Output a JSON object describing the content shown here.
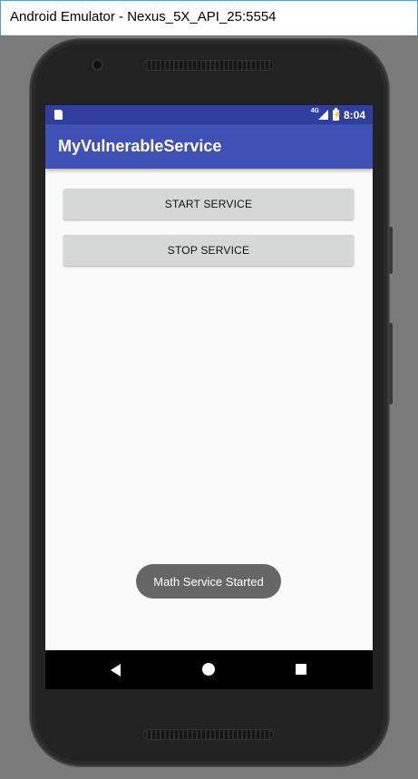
{
  "window": {
    "title": "Android Emulator - Nexus_5X_API_25:5554"
  },
  "statusbar": {
    "network": "4G",
    "time": "8:04",
    "icons": [
      "sd-card-icon",
      "signal-icon",
      "battery-charging-icon"
    ]
  },
  "app": {
    "title": "MyVulnerableService"
  },
  "buttons": {
    "start": "START SERVICE",
    "stop": "STOP SERVICE"
  },
  "toast": {
    "message": "Math Service Started"
  },
  "navbar": {
    "icons": [
      "back-icon",
      "home-icon",
      "recents-icon"
    ]
  },
  "colors": {
    "statusbar": "#303f9f",
    "appbar": "#3f51b5",
    "button": "#d6d7d7",
    "toast": "#666666"
  }
}
